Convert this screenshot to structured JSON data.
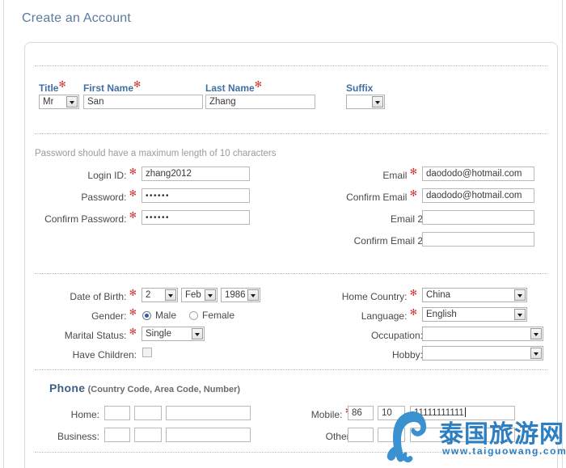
{
  "page": {
    "title": "Create an Account"
  },
  "name_section": {
    "title_label": "Title",
    "title_value": "Mr",
    "first_name_label": "First Name",
    "first_name_value": "San",
    "last_name_label": "Last Name",
    "last_name_value": "Zhang",
    "suffix_label": "Suffix",
    "suffix_value": ""
  },
  "account_section": {
    "password_hint": "Password should have a maximum length of 10 characters",
    "login_id_label": "Login ID:",
    "login_id_value": "zhang2012",
    "password_label": "Password:",
    "password_value": "••••••",
    "confirm_password_label": "Confirm Password:",
    "confirm_password_value": "••••••",
    "email_label": "Email",
    "email_value": "daododo@hotmail.com",
    "confirm_email_label": "Confirm Email",
    "confirm_email_value": "daododo@hotmail.com",
    "email2_label": "Email 2",
    "email2_value": "",
    "confirm_email2_label": "Confirm Email 2",
    "confirm_email2_value": ""
  },
  "personal_section": {
    "dob_label": "Date of Birth:",
    "dob_day": "2",
    "dob_month": "Feb",
    "dob_year": "1986",
    "gender_label": "Gender:",
    "gender_male": "Male",
    "gender_female": "Female",
    "gender_selected": "Male",
    "marital_label": "Marital Status:",
    "marital_value": "Single",
    "children_label": "Have Children:",
    "children_checked": false,
    "home_country_label": "Home Country:",
    "home_country_value": "China",
    "language_label": "Language:",
    "language_value": "English",
    "occupation_label": "Occupation:",
    "occupation_value": "",
    "hobby_label": "Hobby:",
    "hobby_value": ""
  },
  "phone_section": {
    "heading": "Phone",
    "heading_note": "(Country Code, Area Code, Number)",
    "home_label": "Home:",
    "home_country_code": "",
    "home_area_code": "",
    "home_number": "",
    "business_label": "Business:",
    "business_country_code": "",
    "business_area_code": "",
    "business_number": "",
    "mobile_label": "Mobile:",
    "mobile_country_code": "86",
    "mobile_area_code": "10",
    "mobile_number": "11111111111",
    "other_label": "Other:",
    "other_country_code": "",
    "other_area_code": "",
    "other_number": ""
  },
  "watermark": {
    "text_cn": "泰国旅游网",
    "url": "www.taiguowang.com"
  },
  "colors": {
    "heading": "#5a7a9e",
    "label_blue": "#3f6fa5",
    "required": "#cc3333",
    "watermark": "#2e7fc1"
  }
}
